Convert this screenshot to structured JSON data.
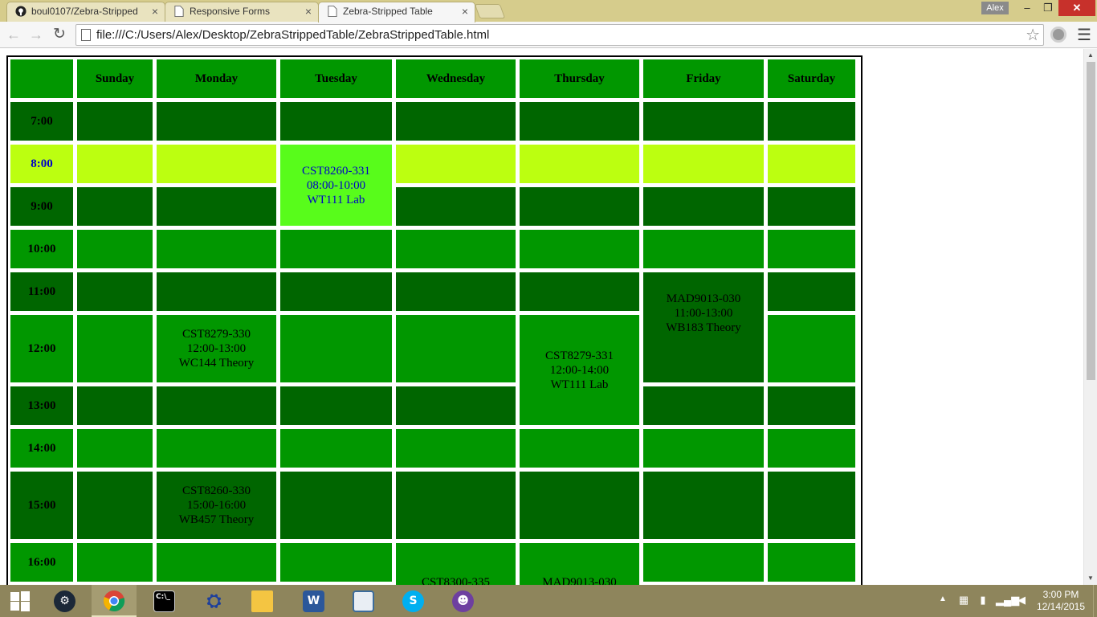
{
  "tabs": [
    {
      "label": "boul0107/Zebra-Stripped",
      "icon": "github-icon",
      "active": false
    },
    {
      "label": "Responsive Forms",
      "icon": "page-icon",
      "active": false
    },
    {
      "label": "Zebra-Stripped Table",
      "icon": "page-icon",
      "active": true
    }
  ],
  "profile": {
    "name": "Alex"
  },
  "window_controls": {
    "minimize": "–",
    "maximize": "❐",
    "close": "✕"
  },
  "toolbar": {
    "back": "←",
    "forward": "→",
    "reload": "↻",
    "url": "file:///C:/Users/Alex/Desktop/ZebraStrippedTable/ZebraStrippedTable.html",
    "star": "☆",
    "menu": "☰"
  },
  "schedule": {
    "header": {
      "corner": "",
      "days": [
        "Sunday",
        "Monday",
        "Tuesday",
        "Wednesday",
        "Thursday",
        "Friday",
        "Saturday"
      ]
    },
    "times": [
      "7:00",
      "8:00",
      "9:00",
      "10:00",
      "11:00",
      "12:00",
      "13:00",
      "14:00",
      "15:00",
      "16:00"
    ],
    "events": {
      "tue_8": [
        "CST8260-331",
        "08:00-10:00",
        "WT111 Lab"
      ],
      "fri_11": [
        "MAD9013-030",
        "11:00-13:00",
        "WB183 Theory"
      ],
      "mon_12": [
        "CST8279-330",
        "12:00-13:00",
        "WC144 Theory"
      ],
      "thu_12": [
        "CST8279-331",
        "12:00-14:00",
        "WT111 Lab"
      ],
      "mon_15": [
        "CST8260-330",
        "15:00-16:00",
        "WB457 Theory"
      ],
      "wed_16": [
        "CST8300-335"
      ],
      "thu_16": [
        "MAD9013-030"
      ]
    },
    "colors": {
      "green": "#019700",
      "dark_green": "#006600",
      "lime": "#bcff10",
      "bright_green": "#58fc1b"
    }
  },
  "taskbar": {
    "apps": [
      {
        "name": "steam",
        "icon": "steam-icon"
      },
      {
        "name": "chrome",
        "icon": "chrome-icon"
      },
      {
        "name": "command-prompt",
        "icon": "terminal-icon"
      },
      {
        "name": "network",
        "icon": "network-icon"
      },
      {
        "name": "file-explorer",
        "icon": "folder-icon"
      },
      {
        "name": "word",
        "icon": "word-icon",
        "glyph": "W"
      },
      {
        "name": "publisher",
        "icon": "publisher-icon"
      },
      {
        "name": "skype",
        "icon": "skype-icon",
        "glyph": "S"
      },
      {
        "name": "github",
        "icon": "github-desktop-icon"
      }
    ],
    "clock": {
      "time": "3:00 PM",
      "date": "12/14/2015"
    }
  }
}
